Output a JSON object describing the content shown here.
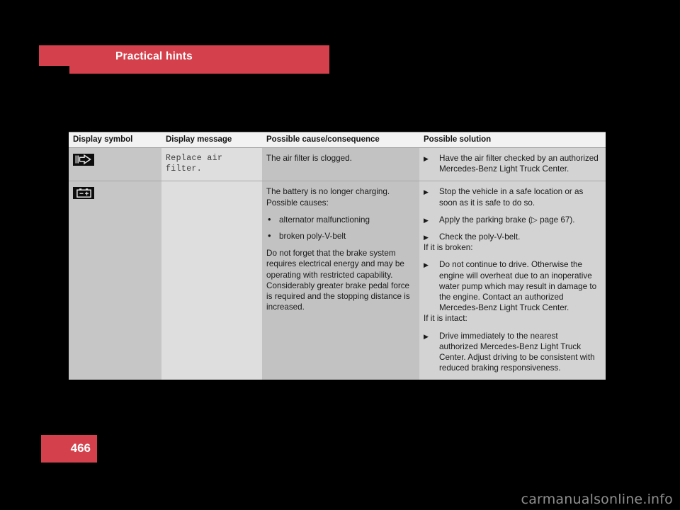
{
  "header": {
    "chapter_title": "Practical hints",
    "accent_color": "#d4404b"
  },
  "table": {
    "columns": [
      "Display symbol",
      "Display message",
      "Possible cause/consequence",
      "Possible solution"
    ],
    "rows": [
      {
        "symbol": "air-filter-icon",
        "message": "Replace air filter.",
        "cause": {
          "intro": "The air filter is clogged.",
          "bullets": [],
          "note": ""
        },
        "solution": {
          "items": [
            "Have the air filter checked by an authorized Mercedes-Benz Light Truck Center."
          ],
          "condition_broken_label": "",
          "broken_items": [],
          "condition_intact_label": "",
          "intact_items": []
        }
      },
      {
        "symbol": "battery-icon",
        "message": "",
        "cause": {
          "intro": "The battery is no longer charging. Possible causes:",
          "bullets": [
            "alternator malfunctioning",
            "broken poly-V-belt"
          ],
          "note": "Do not forget that the brake system requires electrical energy and may be operating with restricted capability. Considerably greater brake pedal force is required and the stopping distance is increased."
        },
        "solution": {
          "items": [
            "Stop the vehicle in a safe location or as soon as it is safe to do so.",
            "Apply the parking brake (▷ page 67).",
            " Check the poly-V-belt."
          ],
          "condition_broken_label": "If it is broken:",
          "broken_items": [
            "Do not continue to drive. Otherwise the engine will overheat due to an inoperative water pump which may result in damage to the engine. Contact an authorized Mercedes-Benz Light Truck Center."
          ],
          "condition_intact_label": "If it is intact:",
          "intact_items": [
            "Drive immediately to the nearest authorized Mercedes-Benz Light Truck Center. Adjust driving to be consistent with reduced braking responsiveness."
          ]
        }
      }
    ]
  },
  "footer": {
    "page_number": "466",
    "watermark": "carmanualsonline.info"
  }
}
